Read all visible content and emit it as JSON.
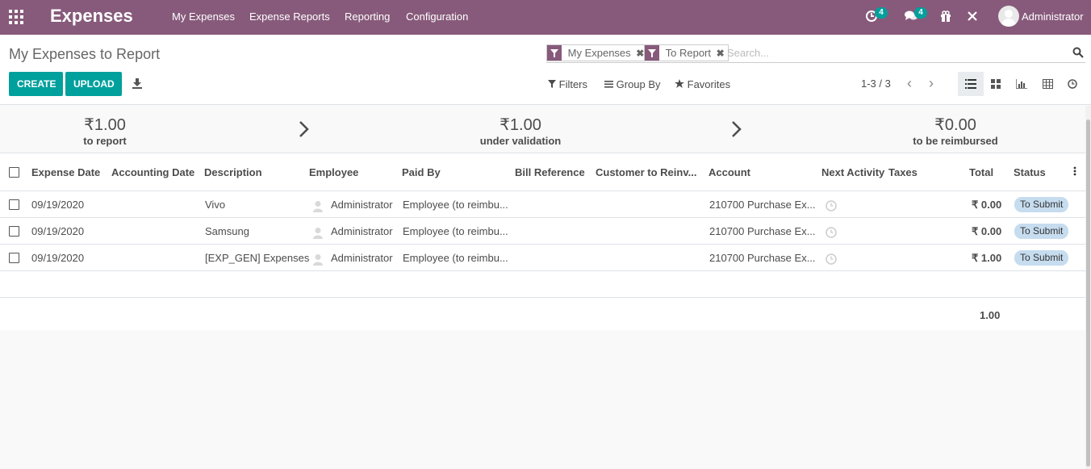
{
  "navbar": {
    "brand": "Expenses",
    "menu": [
      "My Expenses",
      "Expense Reports",
      "Reporting",
      "Configuration"
    ],
    "activity_badge": "4",
    "message_badge": "4",
    "user": "Administrator"
  },
  "control": {
    "title": "My Expenses to Report",
    "create_label": "CREATE",
    "upload_label": "UPLOAD",
    "facets": [
      "My Expenses",
      "To Report"
    ],
    "search_placeholder": "Search...",
    "filters_label": "Filters",
    "groupby_label": "Group By",
    "favorites_label": "Favorites",
    "pager": "1-3 / 3"
  },
  "dashboard": [
    {
      "amount": "₹1.00",
      "label": "to report"
    },
    {
      "amount": "₹1.00",
      "label": "under validation"
    },
    {
      "amount": "₹0.00",
      "label": "to be reimbursed"
    }
  ],
  "table": {
    "columns": [
      "Expense Date",
      "Accounting Date",
      "Description",
      "Employee",
      "Paid By",
      "Bill Reference",
      "Customer to Reinv...",
      "Account",
      "Next Activity",
      "Taxes",
      "Total",
      "Status"
    ],
    "rows": [
      {
        "expense_date": "09/19/2020",
        "accounting_date": "",
        "description": "Vivo",
        "employee": "Administrator",
        "paid_by": "Employee (to reimbu...",
        "account": "210700 Purchase Ex...",
        "total": "₹ 0.00",
        "status": "To Submit"
      },
      {
        "expense_date": "09/19/2020",
        "accounting_date": "",
        "description": "Samsung",
        "employee": "Administrator",
        "paid_by": "Employee (to reimbu...",
        "account": "210700 Purchase Ex...",
        "total": "₹ 0.00",
        "status": "To Submit"
      },
      {
        "expense_date": "09/19/2020",
        "accounting_date": "",
        "description": "[EXP_GEN] Expenses",
        "employee": "Administrator",
        "paid_by": "Employee (to reimbu...",
        "account": "210700 Purchase Ex...",
        "total": "₹ 1.00",
        "status": "To Submit"
      }
    ],
    "grand_total": "1.00"
  },
  "colors": {
    "brand": "#875a7b",
    "primary": "#00a09d",
    "status_badge": "#c6dcef"
  }
}
